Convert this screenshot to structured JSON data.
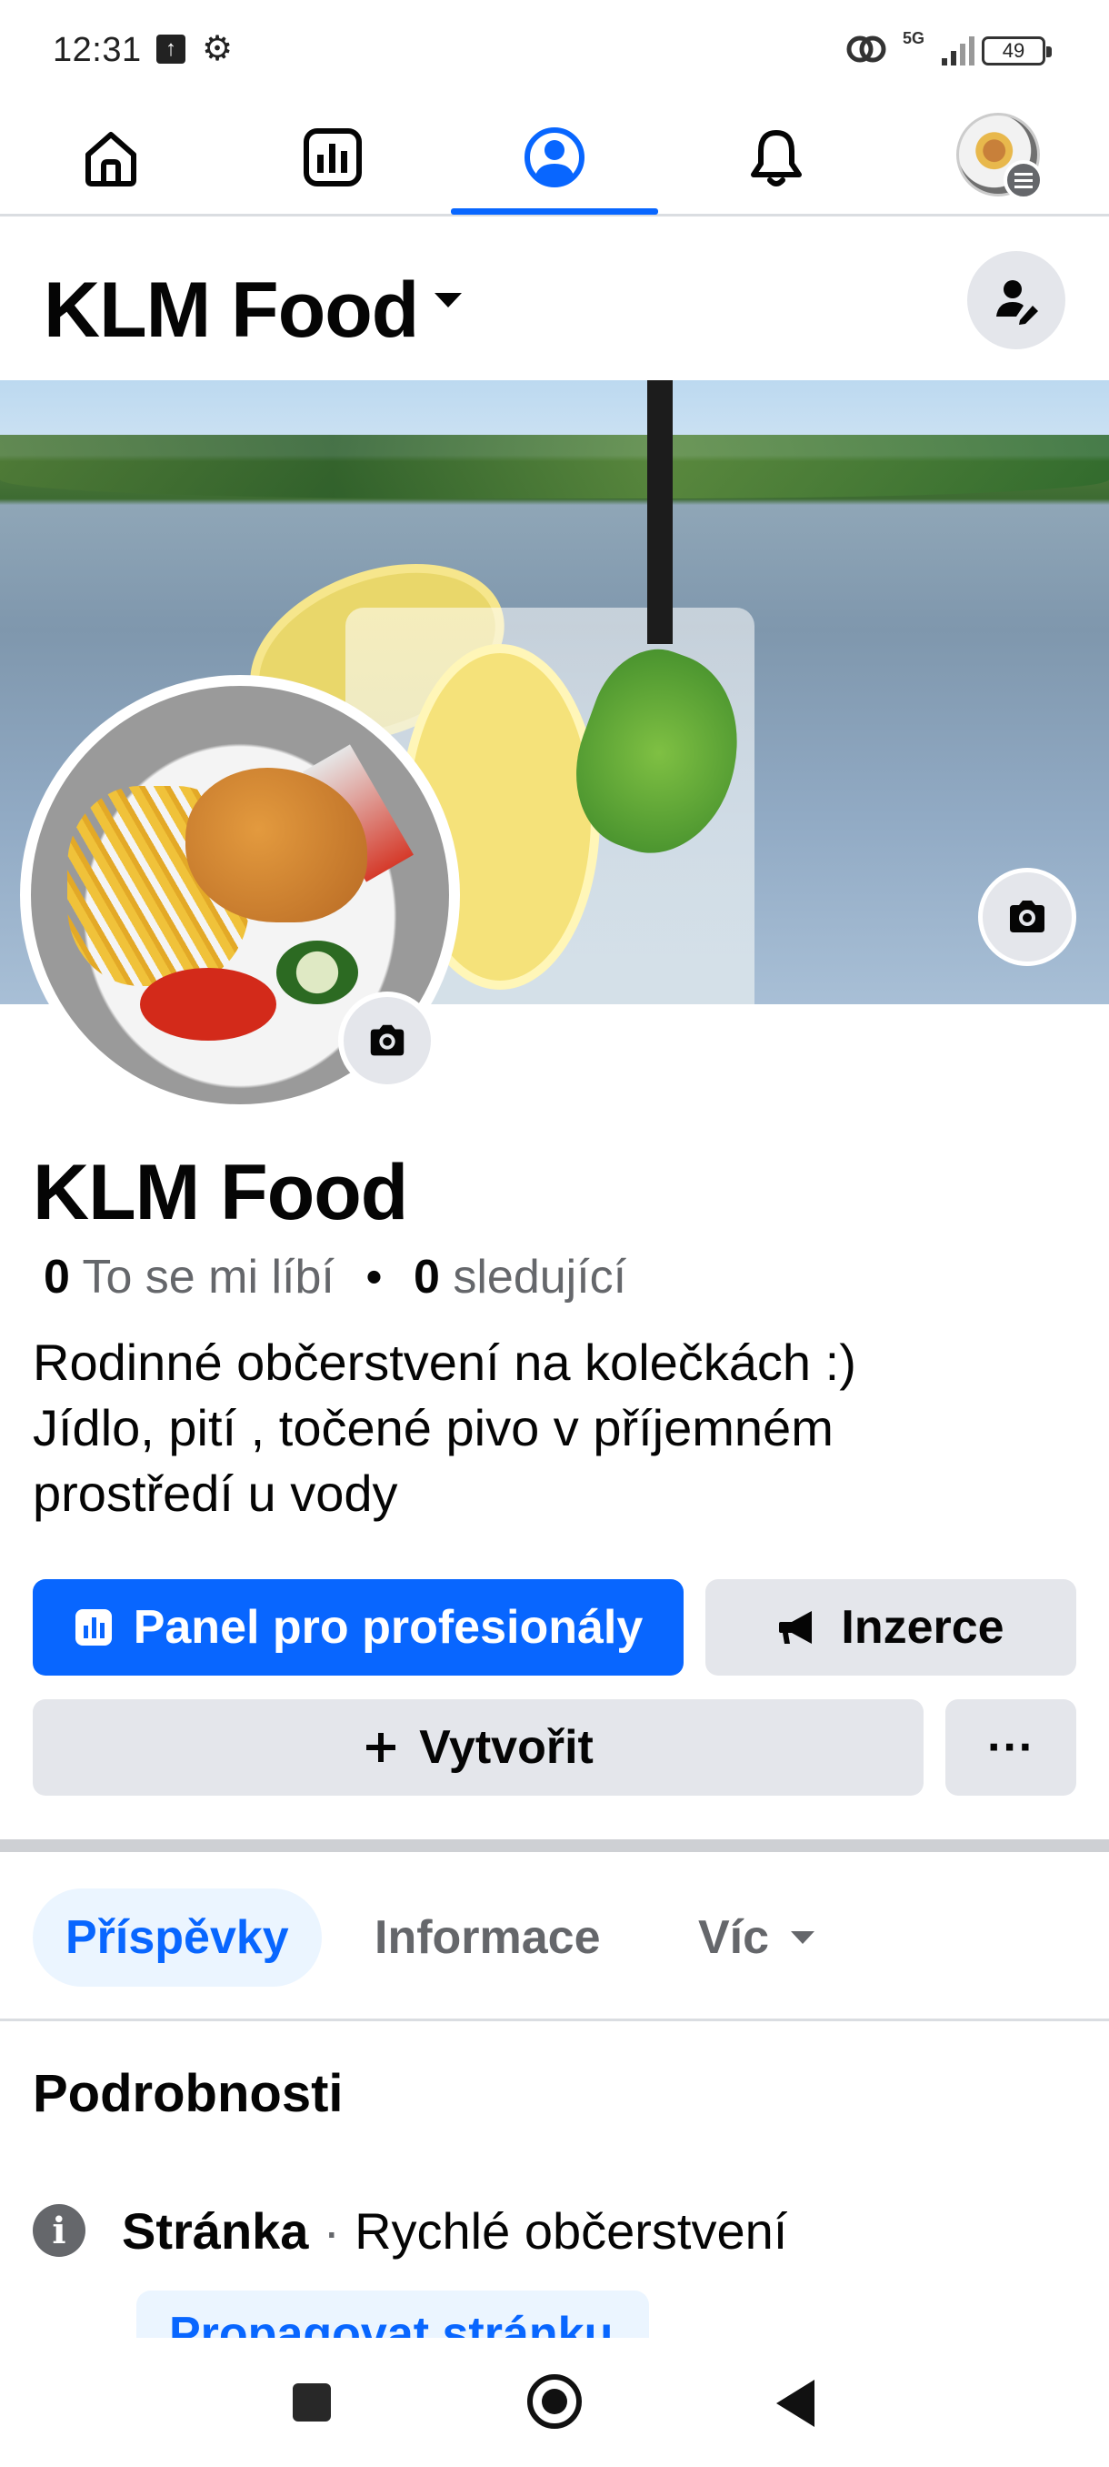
{
  "status_bar": {
    "time": "12:31",
    "network": "5G",
    "battery": "49"
  },
  "top_nav": {
    "items": [
      {
        "icon": "home-icon"
      },
      {
        "icon": "dashboard-icon"
      },
      {
        "icon": "profile-icon",
        "active": true
      },
      {
        "icon": "bell-icon"
      },
      {
        "icon": "account-avatar"
      }
    ],
    "accent": "#0866ff"
  },
  "header": {
    "title": "KLM Food"
  },
  "profile": {
    "name": "KLM Food",
    "likes_count": "0",
    "likes_label": "To se mi líbí",
    "separator": "•",
    "followers_count": "0",
    "followers_label": "sledující",
    "bio_line1": "Rodinné občerstvení na kolečkách :)",
    "bio_line2": "Jídlo, pití , točené pivo v příjemném",
    "bio_line3": "prostředí u vody"
  },
  "actions": {
    "dashboard_label": "Panel pro profesionály",
    "ads_label": "Inzerce",
    "create_label": "Vytvořit",
    "more_label": "···"
  },
  "tabs": {
    "posts": "Příspěvky",
    "info": "Informace",
    "more": "Víc"
  },
  "details": {
    "title": "Podrobnosti",
    "page_type_label": "Stránka",
    "separator": "·",
    "category": "Rychlé občerstvení",
    "promote_label": "Propagovat stránku"
  },
  "colors": {
    "primary": "#0866ff",
    "secondary_button": "#e4e6eb",
    "muted_text": "#65676b",
    "tab_active_bg": "#ebf5ff"
  }
}
